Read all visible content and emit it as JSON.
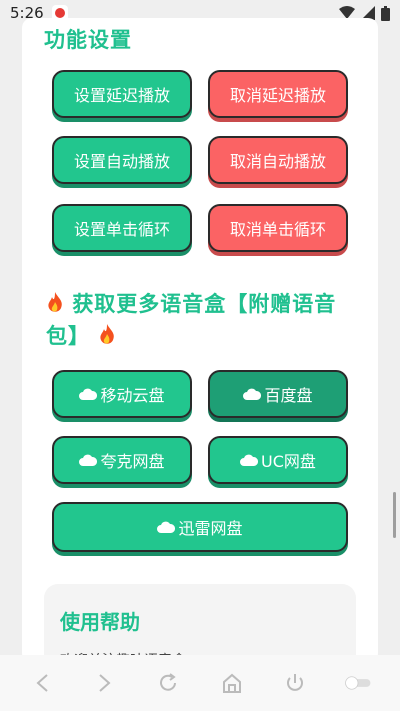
{
  "status_bar": {
    "time": "5:26"
  },
  "features": {
    "title": "功能设置",
    "buttons": [
      {
        "label": "设置延迟播放",
        "color": "#22c68e"
      },
      {
        "label": "取消延迟播放",
        "color": "#fb6364"
      },
      {
        "label": "设置自动播放",
        "color": "#22c68e"
      },
      {
        "label": "取消自动播放",
        "color": "#fb6364"
      },
      {
        "label": "设置单击循环",
        "color": "#22c68e"
      },
      {
        "label": "取消单击循环",
        "color": "#fb6364"
      }
    ]
  },
  "more": {
    "title_line1": "获取更多语音盒【附赠语音",
    "title_line2": "包】",
    "icon": "fire-icon",
    "buttons": [
      {
        "label": "移动云盘"
      },
      {
        "label": "百度盘"
      },
      {
        "label": "夸克网盘"
      },
      {
        "label": "UC网盘"
      },
      {
        "label": "迅雷网盘"
      }
    ]
  },
  "help": {
    "title": "使用帮助",
    "text": "欢迎关注趣味语音盒"
  },
  "nav": [
    "back-icon",
    "forward-icon",
    "refresh-icon",
    "home-icon",
    "power-icon",
    "toggle-icon"
  ],
  "colors": {
    "accent": "#20c08f",
    "green": "#22c68e",
    "red": "#fb6364",
    "dark_green": "#1e9f75"
  }
}
